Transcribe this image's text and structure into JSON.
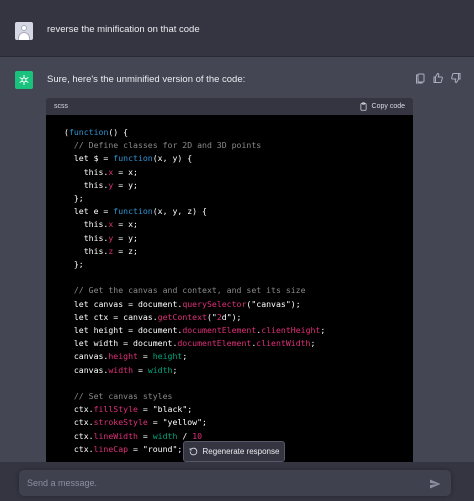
{
  "user_message": "reverse the minification on that code",
  "assistant": {
    "intro": "Sure, here's the unminified version of the code:",
    "code_language": "scss",
    "copy_label": "Copy code",
    "code_lines": [
      "(function() {",
      "  // Define classes for 2D and 3D points",
      "  let $ = function(x, y) {",
      "    this.x = x;",
      "    this.y = y;",
      "  };",
      "  let e = function(x, y, z) {",
      "    this.x = x;",
      "    this.y = y;",
      "    this.z = z;",
      "  };",
      "",
      "  // Get the canvas and context, and set its size",
      "  let canvas = document.querySelector(\"canvas\");",
      "  let ctx = canvas.getContext(\"2d\");",
      "  let height = document.documentElement.clientHeight;",
      "  let width = document.documentElement.clientWidth;",
      "  canvas.height = height;",
      "  canvas.width = width;",
      "",
      "  // Set canvas styles",
      "  ctx.fillStyle = \"black\";",
      "  ctx.strokeStyle = \"yellow\";",
      "  ctx.lineWidth = width / 10",
      "  ctx.lineCap = \"round\";"
    ]
  },
  "regenerate_label": "Regenerate response",
  "input": {
    "placeholder": "Send a message."
  },
  "colors": {
    "bg": "#343541",
    "assistant_bg": "#444654",
    "accent": "#19c37d",
    "code_bg": "#000000"
  }
}
